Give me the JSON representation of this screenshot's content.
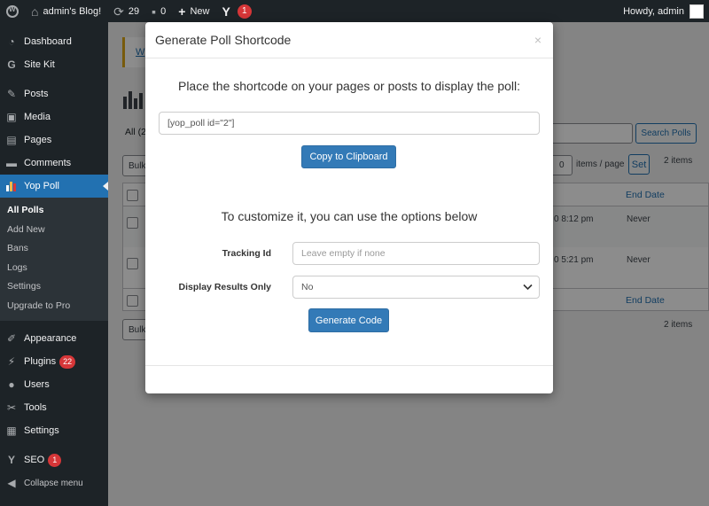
{
  "adminbar": {
    "site_name": "admin's Blog!",
    "updates_count": "29",
    "comments_count": "0",
    "new_label": "New",
    "seo_badge": "1",
    "greeting": "Howdy, admin"
  },
  "sidebar": {
    "items": [
      {
        "label": "Dashboard",
        "icon": "dashboard-icon"
      },
      {
        "label": "Site Kit",
        "icon": "google-g-icon"
      },
      {
        "label": "Posts",
        "icon": "pin-icon"
      },
      {
        "label": "Media",
        "icon": "media-icon"
      },
      {
        "label": "Pages",
        "icon": "pages-icon"
      },
      {
        "label": "Comments",
        "icon": "comment-icon"
      },
      {
        "label": "Yop Poll",
        "icon": "poll-icon"
      }
    ],
    "submenu": [
      "All Polls",
      "Add New",
      "Bans",
      "Logs",
      "Settings",
      "Upgrade to Pro"
    ],
    "items2": [
      {
        "label": "Appearance",
        "icon": "brush-icon"
      },
      {
        "label": "Plugins",
        "icon": "plugin-icon",
        "badge": "22"
      },
      {
        "label": "Users",
        "icon": "user-icon"
      },
      {
        "label": "Tools",
        "icon": "wrench-icon"
      },
      {
        "label": "Settings",
        "icon": "settings-icon"
      }
    ],
    "seo": {
      "label": "SEO",
      "badge": "1"
    },
    "collapse": "Collapse menu"
  },
  "background": {
    "notice_text": "W",
    "filter_all": "All (2",
    "search_button": "Search Polls",
    "bulk_top": "Bulk",
    "bulk_bottom": "Bulk",
    "items_count_top": "2 items",
    "items_count_bottom": "2 items",
    "items_per_page_value": "0",
    "items_per_page_label": "items / page",
    "set_button": "Set",
    "col_end_date": "End Date",
    "col_end_date_footer": "End Date",
    "rows": [
      {
        "date_fragment": "0 8:12 pm",
        "end": "Never"
      },
      {
        "date_fragment": "0 5:21 pm",
        "end": "Never"
      }
    ]
  },
  "modal": {
    "title": "Generate Poll Shortcode",
    "close": "×",
    "intro": "Place the shortcode on your pages or posts to display the poll:",
    "shortcode": "[yop_poll id=\"2\"]",
    "copy_button": "Copy to Clipboard",
    "customize_text": "To customize it, you can use the options below",
    "tracking_label": "Tracking Id",
    "tracking_placeholder": "Leave empty if none",
    "results_label": "Display Results Only",
    "results_value": "No",
    "generate_button": "Generate Code"
  },
  "colors": {
    "accent": "#2271b1",
    "adminbar_bg": "#1d2327",
    "button_primary": "#337ab7",
    "badge": "#d63638"
  }
}
